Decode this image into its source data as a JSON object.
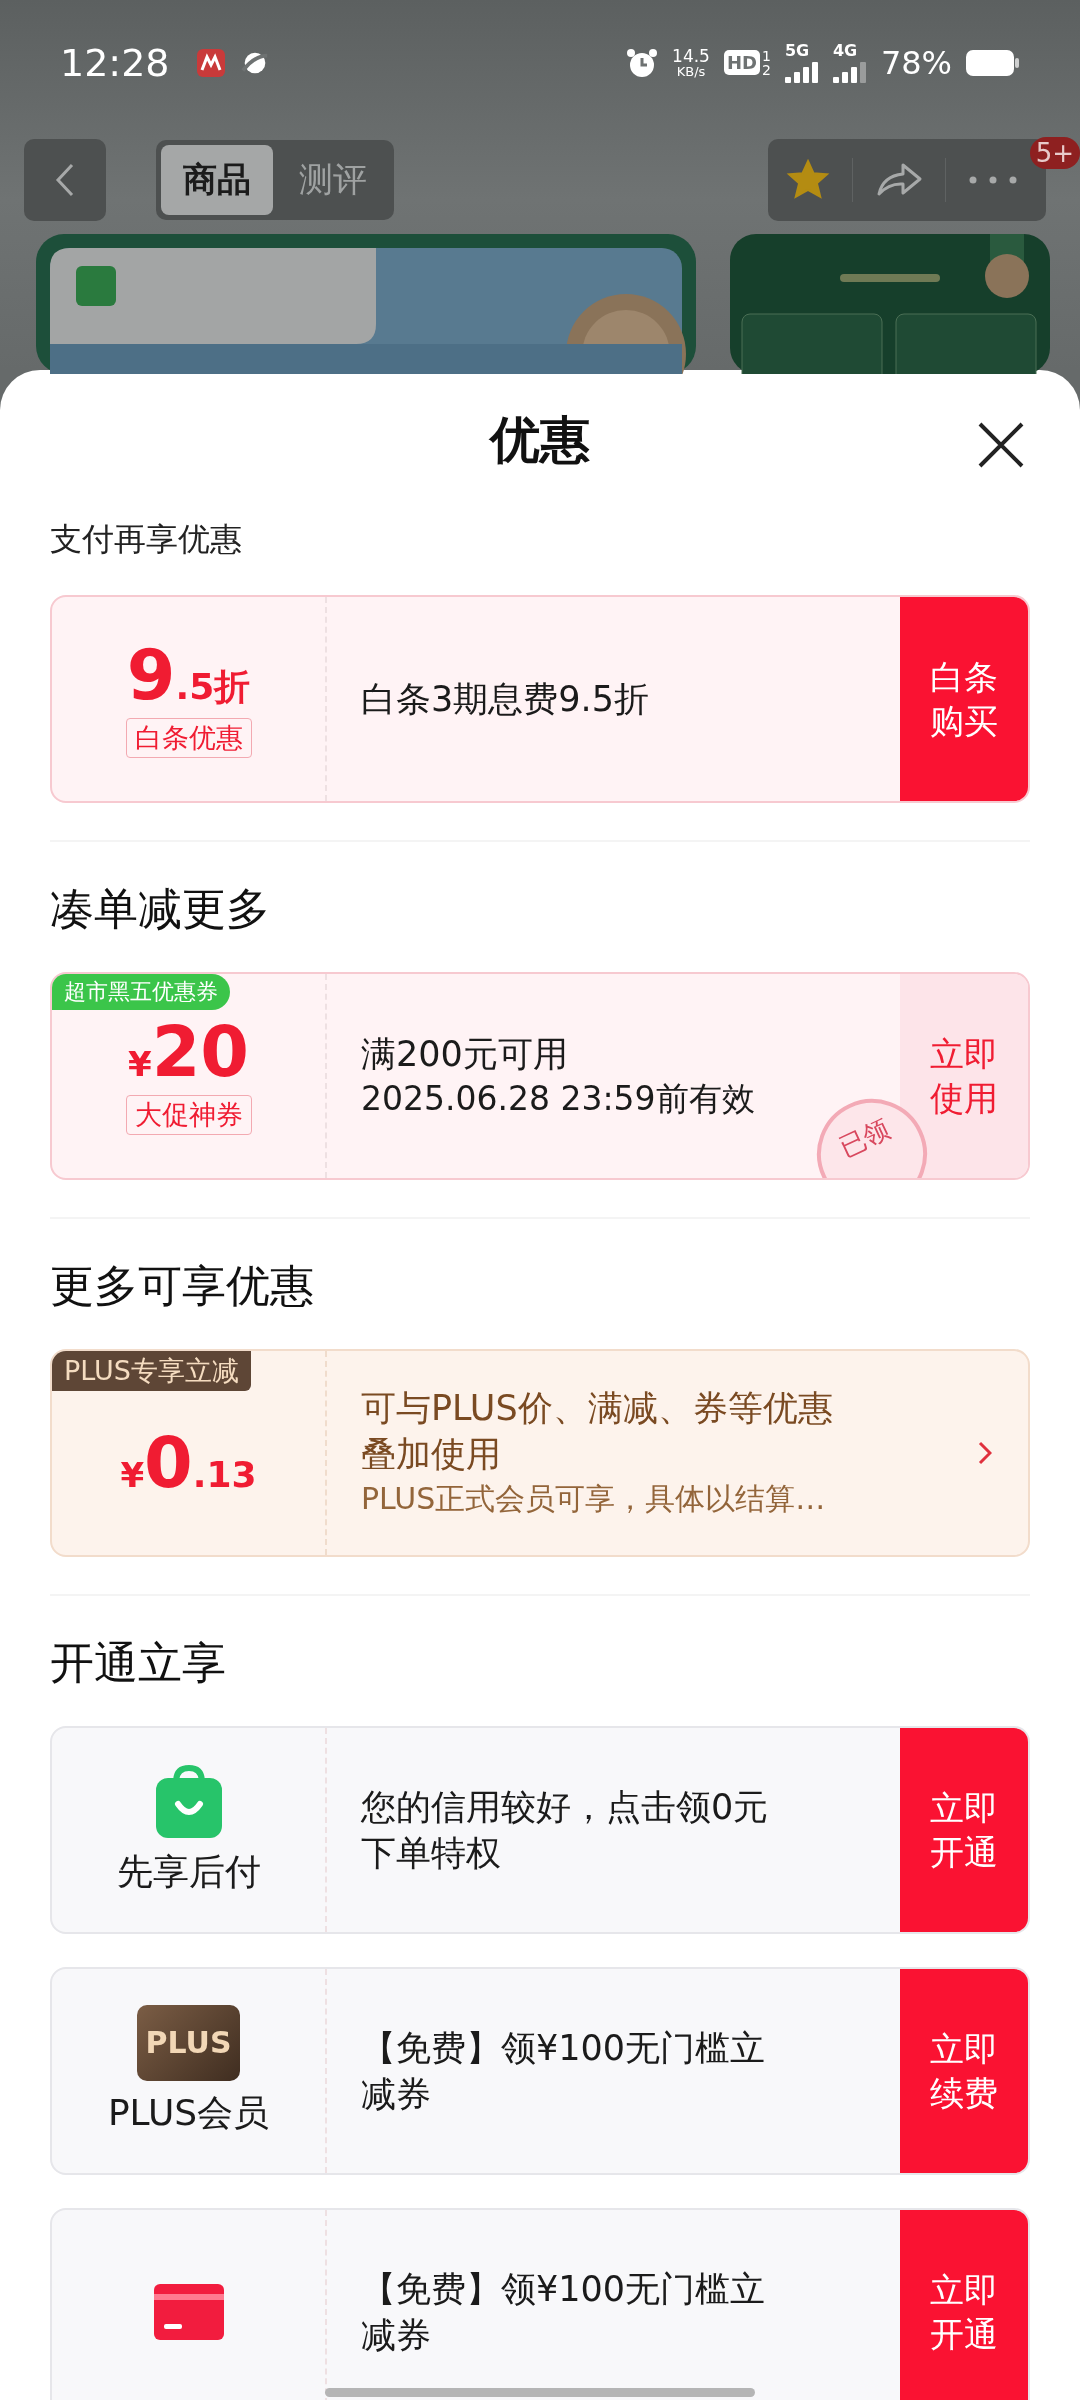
{
  "status_bar": {
    "time": "12:28",
    "net_speed": "14.5",
    "net_unit": "KB/s",
    "hd": {
      "label": "HD",
      "sims": [
        "1",
        "2"
      ]
    },
    "sim_1": "5G",
    "sim_2": "4G",
    "battery": "78%"
  },
  "nav": {
    "tabs": [
      {
        "label": "商品",
        "selected": true
      },
      {
        "label": "测评",
        "selected": false
      }
    ],
    "favorite": {
      "on": true
    },
    "badge": "5+"
  },
  "sheet": {
    "title": "优惠",
    "sections": [
      {
        "title": "支付再享优惠",
        "offers": [
          {
            "kind": "discount",
            "amount": "9",
            "amount_suffix": ".5折",
            "tag": "白条优惠",
            "text": "白条3期息费9.5折",
            "action": "白条购买"
          }
        ]
      },
      {
        "title": "凑单减更多",
        "offers": [
          {
            "kind": "coupon",
            "corner_label": "超市黑五优惠券",
            "currency": "¥",
            "amount": "20",
            "tag": "大促神券",
            "text": "满200元可用",
            "subtext": "2025.06.28 23:59前有效",
            "action": "立即使用",
            "stamp": "已领"
          }
        ]
      },
      {
        "title": "更多可享优惠",
        "offers": [
          {
            "kind": "plus",
            "corner_label": "PLUS专享立减",
            "currency": "¥",
            "amount": "0",
            "amount_suffix": ".13",
            "text": "可与PLUS价、满减、券等优惠叠加使用",
            "subtext": "PLUS正式会员可享，具体以结算…"
          }
        ]
      },
      {
        "title": "开通立享",
        "offers": [
          {
            "kind": "paylater",
            "label": "先享后付",
            "text": "您的信用较好，点击领0元下单特权",
            "action": "立即开通"
          },
          {
            "kind": "membership",
            "icon_text": "PLUS",
            "label": "PLUS会员",
            "text": "【免费】领¥100无门槛立减券",
            "action": "立即续费"
          },
          {
            "kind": "card",
            "text": "【免费】领¥100无门槛立减券",
            "action": "立即开通"
          }
        ]
      }
    ]
  }
}
